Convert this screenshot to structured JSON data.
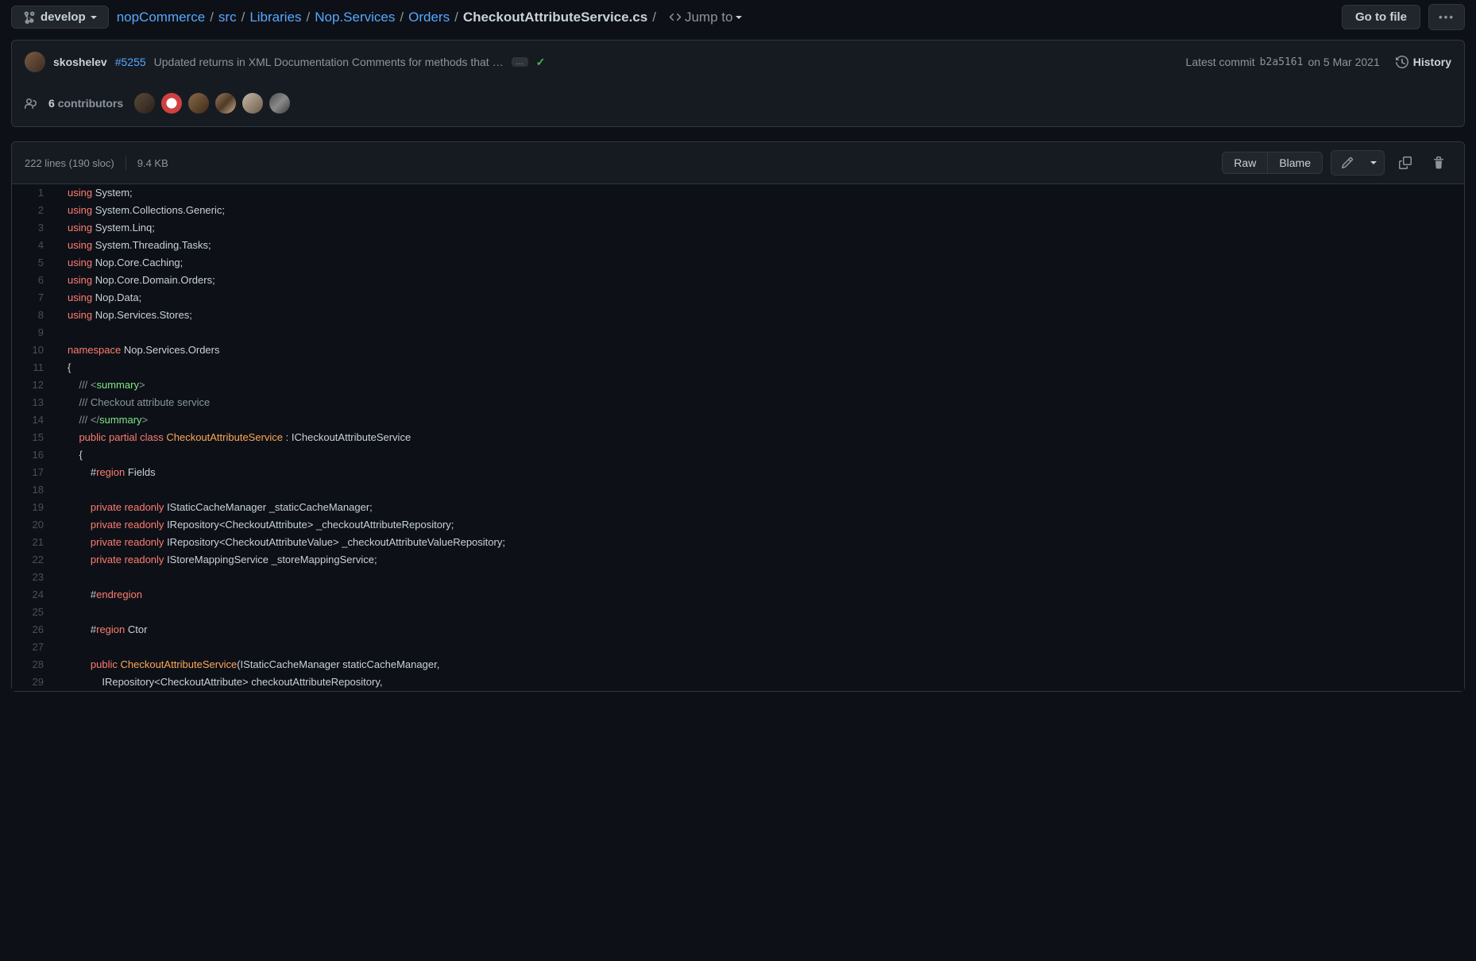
{
  "branch": "develop",
  "crumbs": [
    "nopCommerce",
    "src",
    "Libraries",
    "Nop.Services",
    "Orders"
  ],
  "file": "CheckoutAttributeService.cs",
  "jumpto": "Jump to",
  "gotofile": "Go to file",
  "commit": {
    "author": "skoshelev",
    "issue": "#5255",
    "msg": "Updated returns in XML Documentation Comments for methods that …",
    "latestLabel": "Latest commit",
    "sha": "b2a5161",
    "date": "on 5 Mar 2021",
    "history": "History"
  },
  "contrib": {
    "count": "6",
    "label": "contributors"
  },
  "fileinfo": {
    "lines": "222 lines (190 sloc)",
    "size": "9.4 KB"
  },
  "tools": {
    "raw": "Raw",
    "blame": "Blame"
  },
  "code": {
    "using": "using",
    "namespace": "namespace",
    "public": "public",
    "partial": "partial",
    "class": "class",
    "private": "private",
    "readonly": "readonly",
    "region": "region",
    "endregion": "endregion",
    "u1": "System",
    "u2": "System.Collections.Generic",
    "u3": "System.Linq",
    "u4": "System.Threading.Tasks",
    "u5": "Nop.Core.Caching",
    "u6": "Nop.Core.Domain.Orders",
    "u7": "Nop.Data",
    "u8": "Nop.Services.Stores",
    "nsName": "Nop.Services.Orders",
    "sumOpen": "summary",
    "sumClose": "summary",
    "sumText": "/// Checkout attribute service",
    "className": "CheckoutAttributeService",
    "iface": "ICheckoutAttributeService",
    "rFields": "Fields",
    "rCtor": "Ctor",
    "f1t": "IStaticCacheManager",
    "f1n": "_staticCacheManager",
    "f2t": "IRepository",
    "f2g": "CheckoutAttribute",
    "f2n": "_checkoutAttributeRepository",
    "f3t": "IRepository",
    "f3g": "CheckoutAttributeValue",
    "f3n": "_checkoutAttributeValueRepository",
    "f4t": "IStoreMappingService",
    "f4n": "_storeMappingService",
    "ctor": "CheckoutAttributeService",
    "p1t": "IStaticCacheManager",
    "p1n": "staticCacheManager",
    "p2t": "IRepository",
    "p2g": "CheckoutAttribute",
    "p2n": "checkoutAttributeRepository"
  }
}
